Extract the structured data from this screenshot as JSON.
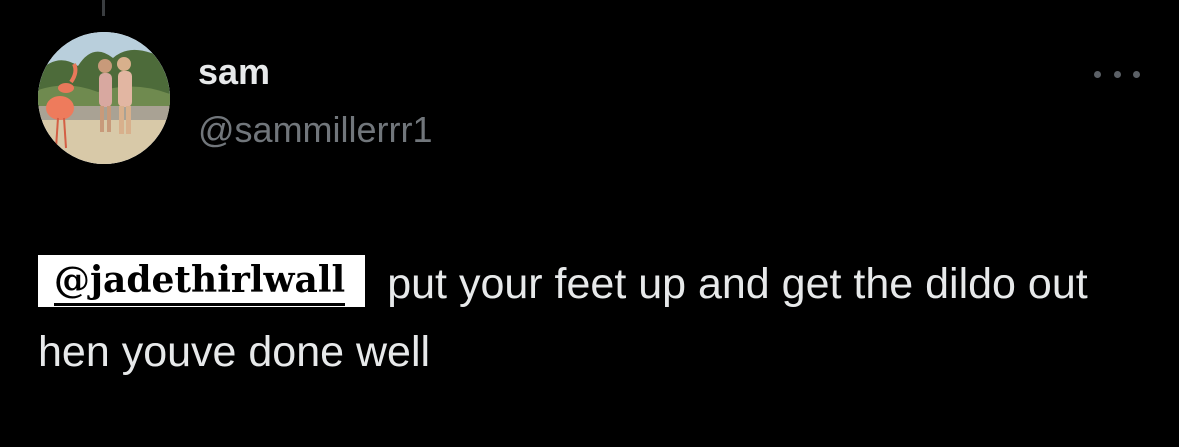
{
  "tweet": {
    "display_name": "sam",
    "handle": "@sammillerrr1",
    "mention": "@jadethirlwall",
    "body": "put your feet up and get the dildo out hen youve done well"
  },
  "icons": {
    "more": "more-horizontal-icon",
    "avatar": "profile-photo"
  },
  "colors": {
    "background": "#000000",
    "primary_text": "#e7e9ea",
    "secondary_text": "#71767b",
    "mention_sticker_bg": "#ffffff",
    "mention_sticker_text": "#000000"
  }
}
